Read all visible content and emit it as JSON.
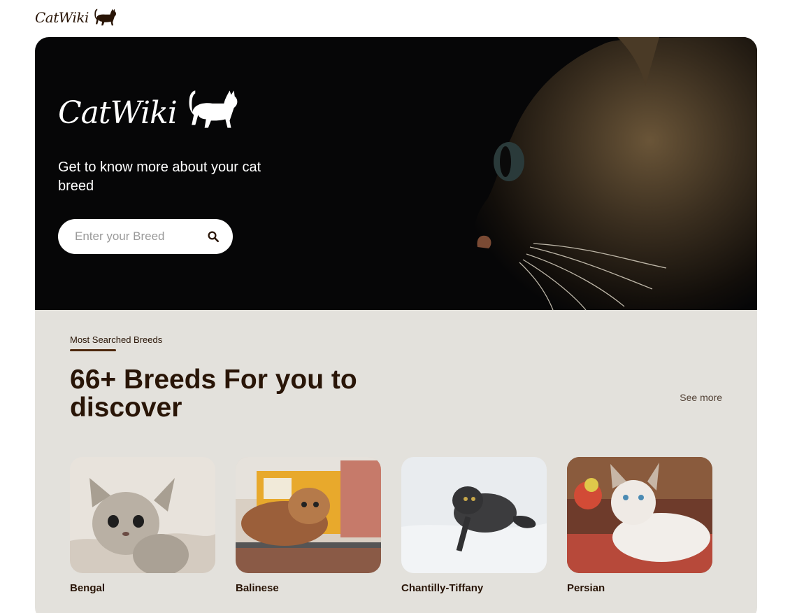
{
  "brand": {
    "name": "CatWiki"
  },
  "hero": {
    "tagline": "Get to know more about your cat breed",
    "search": {
      "placeholder": "Enter your Breed",
      "value": ""
    }
  },
  "breeds_section": {
    "label": "Most Searched Breeds",
    "headline": "66+ Breeds For you to discover",
    "see_more": "See more",
    "cards": [
      {
        "name": "Bengal"
      },
      {
        "name": "Balinese"
      },
      {
        "name": "Chantilly-Tiffany"
      },
      {
        "name": "Persian"
      }
    ]
  },
  "colors": {
    "text_dark": "#291507",
    "hero_bg": "#060607",
    "section_bg": "#e3e1dc",
    "accent_underline": "#4d270c"
  },
  "icons": [
    "cat-silhouette-icon",
    "search-icon"
  ]
}
